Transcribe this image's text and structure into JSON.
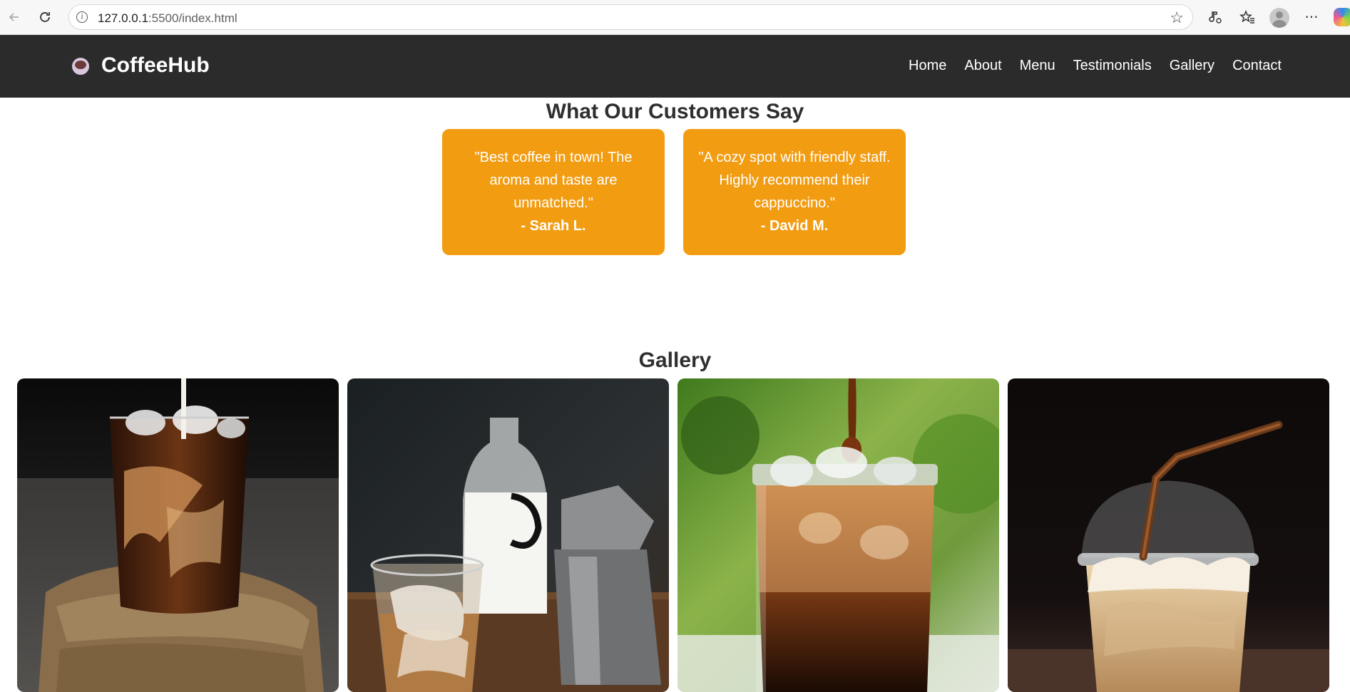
{
  "browser": {
    "url_host": "127.0.0.1",
    "url_rest": ":5500/index.html"
  },
  "site": {
    "brand": "CoffeeHub",
    "nav": [
      "Home",
      "About",
      "Menu",
      "Testimonials",
      "Gallery",
      "Contact"
    ]
  },
  "testimonials": {
    "title": "What Our Customers Say",
    "items": [
      {
        "quote": "\"Best coffee in town! The aroma and taste are unmatched.\"",
        "author": "- Sarah L."
      },
      {
        "quote": "\"A cozy spot with friendly staff. Highly recommend their cappuccino.\"",
        "author": "- David M."
      }
    ]
  },
  "gallery": {
    "title": "Gallery",
    "images": [
      "iced-coffee-milk-pour",
      "iced-coffee-moka-pot",
      "iced-coffee-mason-jar",
      "iced-latte-dome-cup"
    ]
  },
  "icons": {
    "back": "back-arrow-icon",
    "reload": "reload-icon",
    "info": "info-icon",
    "favorite": "star-icon",
    "logo": "coffee-cup-icon"
  }
}
